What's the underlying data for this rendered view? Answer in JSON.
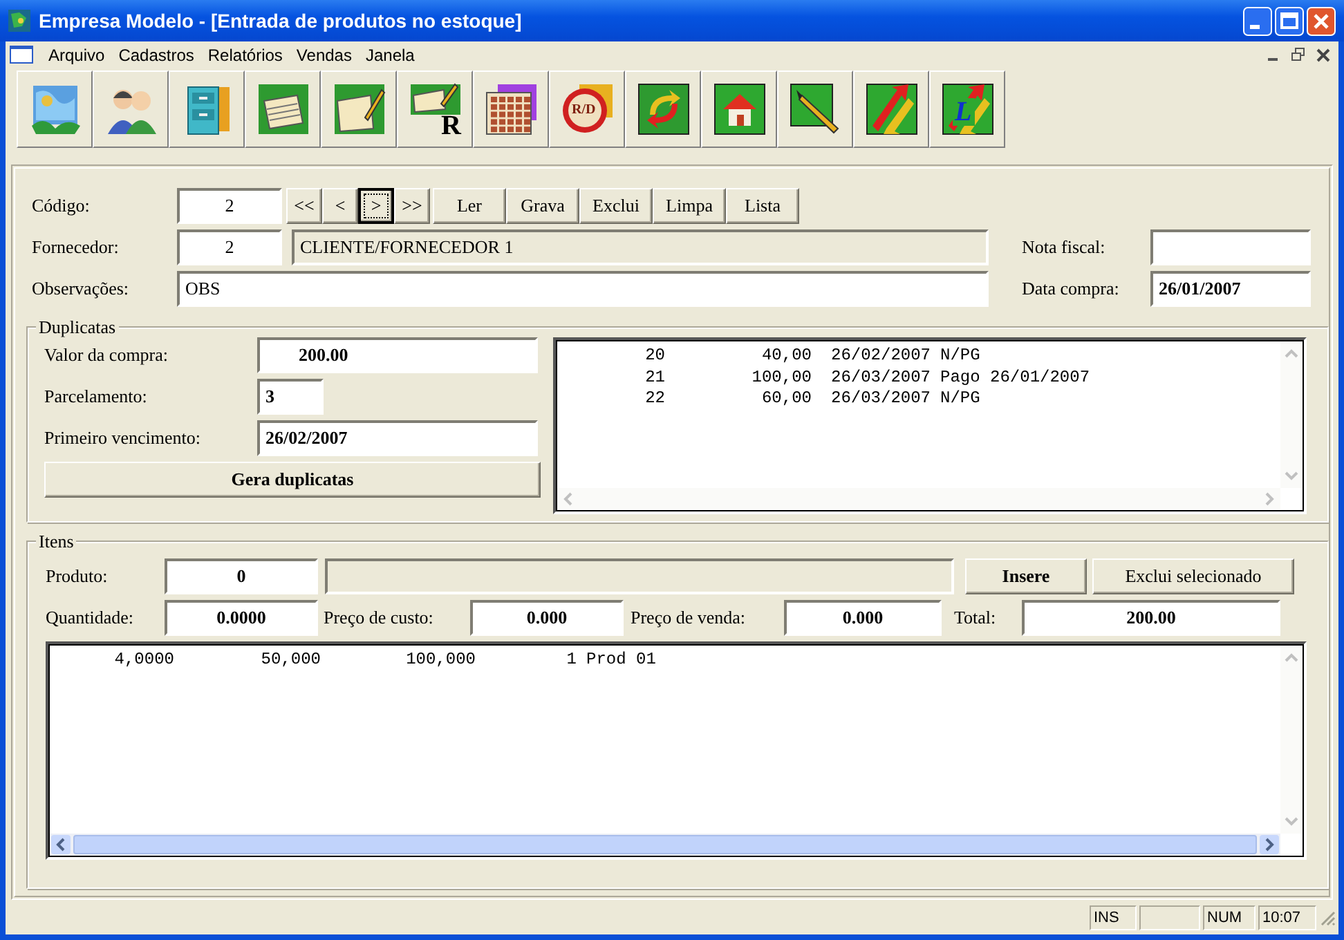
{
  "window": {
    "title": "Empresa Modelo - [Entrada de produtos no estoque]"
  },
  "menu": [
    "Arquivo",
    "Cadastros",
    "Relatórios",
    "Vendas",
    "Janela"
  ],
  "toolbar": [
    {
      "kind": "map"
    },
    {
      "kind": "people"
    },
    {
      "kind": "cabinet"
    },
    {
      "kind": "cards"
    },
    {
      "kind": "note"
    },
    {
      "kind": "report",
      "glyph": "R"
    },
    {
      "kind": "calendar"
    },
    {
      "kind": "badge",
      "glyph": "R/D"
    },
    {
      "kind": "sync"
    },
    {
      "kind": "home"
    },
    {
      "kind": "pen"
    },
    {
      "kind": "arrows"
    },
    {
      "kind": "arrows",
      "glyph": "L"
    }
  ],
  "form": {
    "codigo": {
      "label": "Código:",
      "value": "2"
    },
    "nav_buttons": [
      {
        "label": "<<",
        "focused": false
      },
      {
        "label": "<",
        "focused": false
      },
      {
        "label": ">",
        "focused": true
      },
      {
        "label": ">>",
        "focused": false
      }
    ],
    "action_buttons": [
      "Ler",
      "Grava",
      "Exclui",
      "Limpa",
      "Lista"
    ],
    "fornecedor": {
      "label": "Fornecedor:",
      "code": "2",
      "name": "CLIENTE/FORNECEDOR 1"
    },
    "nota_fiscal": {
      "label": "Nota fiscal:"
    },
    "observacoes": {
      "label": "Observações:",
      "value": "OBS"
    },
    "data_compra": {
      "label": "Data compra:",
      "value": "26/01/2007"
    }
  },
  "duplicatas": {
    "title": "Duplicatas",
    "fields": [
      {
        "label": "Valor da compra:",
        "value": "200.00",
        "kind": "wide"
      },
      {
        "label": "Parcelamento:",
        "value": "3",
        "kind": "short"
      },
      {
        "label": "Primeiro vencimento:",
        "value": "26/02/2007",
        "kind": "date"
      }
    ],
    "button": "Gera duplicatas",
    "rows": [
      [
        "20",
        "40,00",
        "26/02/2007",
        "N/PG"
      ],
      [
        "21",
        "100,00",
        "26/03/2007",
        "Pago 26/01/2007"
      ],
      [
        "22",
        "60,00",
        "26/03/2007",
        "N/PG"
      ]
    ]
  },
  "itens": {
    "title": "Itens",
    "produto": {
      "label": "Produto:",
      "code": "0"
    },
    "insert_button": "Insere",
    "delete_button": "Exclui selecionado",
    "fields": [
      {
        "label": "Quantidade:",
        "value": "0.0000"
      },
      {
        "label": "Preço de custo:",
        "value": "0.000"
      },
      {
        "label": "Preço de venda:",
        "value": "0.000"
      },
      {
        "label": "Total:",
        "value": "200.00"
      }
    ],
    "rows": [
      [
        "4,0000",
        "50,000",
        "100,000",
        "1",
        "Prod 01"
      ]
    ]
  },
  "status_bar": {
    "ins": "INS",
    "num": "NUM",
    "clock": "10:07"
  }
}
